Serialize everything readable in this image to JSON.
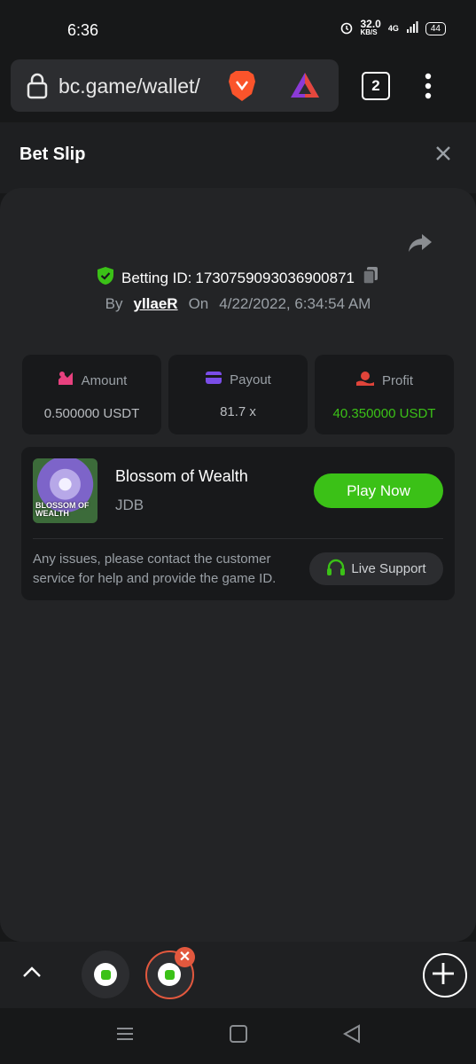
{
  "status_bar": {
    "time": "6:36",
    "speed_value": "32.0",
    "speed_unit": "KB/S",
    "network": "4G",
    "battery": "44"
  },
  "browser": {
    "url": "bc.game/wallet/",
    "tab_count": "2"
  },
  "sheet": {
    "title": "Bet Slip"
  },
  "bet": {
    "betting_id_label": "Betting ID:",
    "betting_id": "1730759093036900871",
    "by_label": "By",
    "username": "yllaeR",
    "on_label": "On",
    "datetime": "4/22/2022, 6:34:54 AM"
  },
  "stats": [
    {
      "label": "Amount",
      "value": "0.500000 USDT",
      "icon": "amount-icon",
      "color": "#e8417f"
    },
    {
      "label": "Payout",
      "value": "81.7 x",
      "icon": "payout-card-icon",
      "color": "#7a4de8"
    },
    {
      "label": "Profit",
      "value": "40.350000 USDT",
      "icon": "profit-icon",
      "color": "#e0443a",
      "value_color": "#3bc117"
    }
  ],
  "game": {
    "thumb_text": "BLOSSOM OF WEALTH",
    "name": "Blossom of Wealth",
    "provider": "JDB",
    "play_label": "Play Now"
  },
  "support": {
    "text": "Any issues, please contact the customer service for help and provide the game ID.",
    "button_label": "Live Support"
  },
  "colors": {
    "accent_green": "#3bc117",
    "background": "#171819",
    "panel": "#232426"
  }
}
